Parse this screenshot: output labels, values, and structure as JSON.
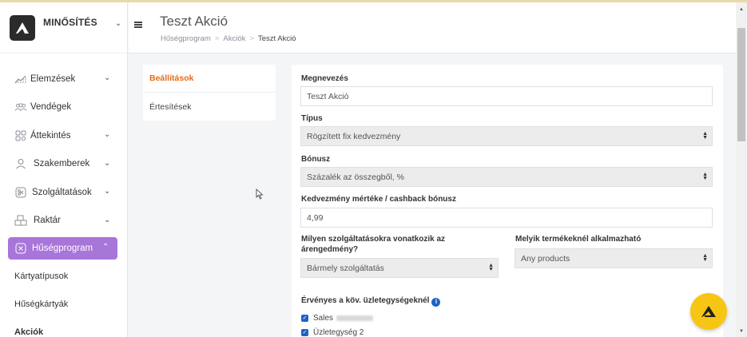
{
  "brand": {
    "name": "MINŐSÍTÉS"
  },
  "sidebar": {
    "items": [
      {
        "label": "Elemzések",
        "icon": "chart-icon",
        "has_chevron": true
      },
      {
        "label": "Vendégek",
        "icon": "users-icon",
        "has_chevron": false
      },
      {
        "label": "Áttekintés",
        "icon": "grid-icon",
        "has_chevron": true
      },
      {
        "label": "Szakemberek",
        "icon": "person-icon",
        "has_chevron": true
      },
      {
        "label": "Szolgáltatások",
        "icon": "scissors-icon",
        "has_chevron": true
      },
      {
        "label": "Raktár",
        "icon": "boxes-icon",
        "has_chevron": true
      },
      {
        "label": "Hűségprogram",
        "icon": "loyalty-icon",
        "has_chevron": true,
        "active": true
      }
    ],
    "sub_items": [
      {
        "label": "Kártyatípusok"
      },
      {
        "label": "Hűségkártyák"
      },
      {
        "label": "Akciók",
        "active": true
      }
    ]
  },
  "header": {
    "title": "Teszt Akció",
    "breadcrumbs": [
      "Hűségprogram",
      "Akciók",
      "Teszt Akció"
    ]
  },
  "settings_nav": {
    "items": [
      {
        "label": "Beállítások",
        "active": true
      },
      {
        "label": "Értesítések"
      }
    ]
  },
  "form": {
    "name_label": "Megnevezés",
    "name_value": "Teszt Akció",
    "type_label": "Típus",
    "type_value": "Rögzített fix kedvezmény",
    "bonus_label": "Bónusz",
    "bonus_value": "Százalék az összegből, %",
    "discount_label": "Kedvezmény mértéke / cashback bónusz",
    "discount_value": "4,99",
    "services_label": "Milyen szolgáltatásokra vonatkozik az árengedmény?",
    "services_value": "Bármely szolgáltatás",
    "products_label": "Melyik termékeknél alkalmazható",
    "products_value": "Any products",
    "locations_label": "Érvényes a köv. üzletegységeknél",
    "locations": [
      {
        "label": "Sales",
        "checked": true,
        "redacted": true
      },
      {
        "label": "Üzletegység 2",
        "checked": true
      }
    ]
  },
  "colors": {
    "accent_purple": "#a875d9",
    "active_orange": "#e36b1c",
    "fab_yellow": "#f7c614",
    "checkbox_blue": "#1e63c6"
  }
}
